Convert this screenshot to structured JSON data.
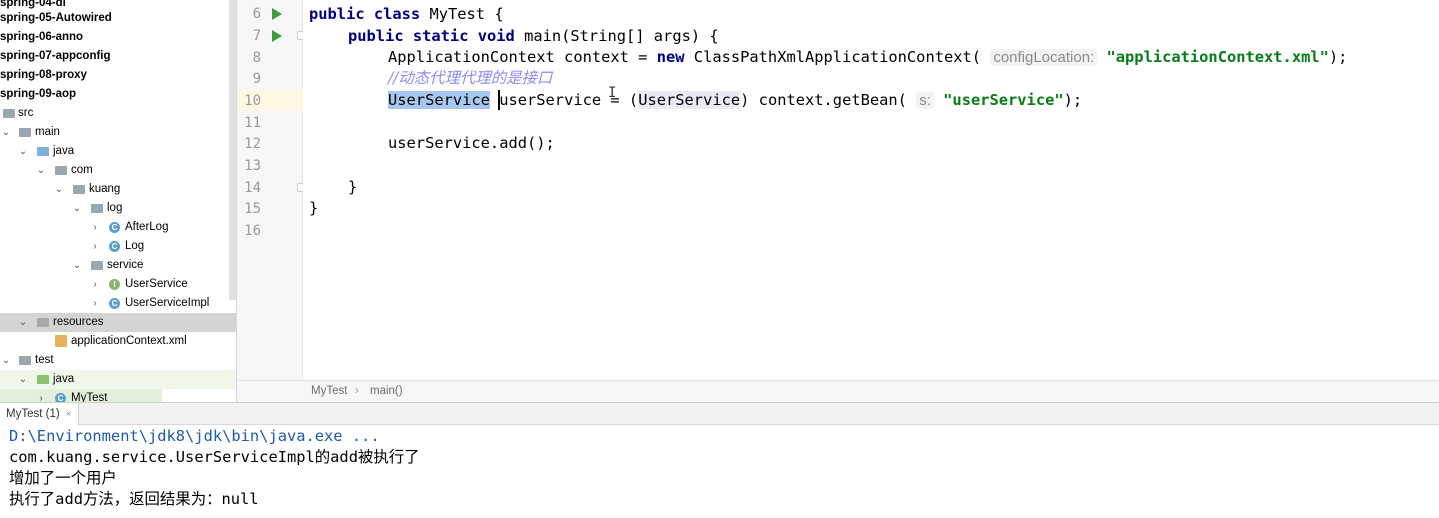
{
  "tree": {
    "items": [
      {
        "label": "spring-04-di",
        "bold": true
      },
      {
        "label": "spring-05-Autowired",
        "bold": true
      },
      {
        "label": "spring-06-anno",
        "bold": true
      },
      {
        "label": "spring-07-appconfig",
        "bold": true
      },
      {
        "label": "spring-08-proxy",
        "bold": true
      },
      {
        "label": "spring-09-aop",
        "bold": true
      },
      {
        "label": "src"
      },
      {
        "label": "main"
      },
      {
        "label": "java"
      },
      {
        "label": "com"
      },
      {
        "label": "kuang"
      },
      {
        "label": "log"
      },
      {
        "label": "AfterLog",
        "icon_text": "C"
      },
      {
        "label": "Log",
        "icon_text": "C"
      },
      {
        "label": "service"
      },
      {
        "label": "UserService",
        "icon_text": "I"
      },
      {
        "label": "UserServiceImpl",
        "icon_text": "C"
      },
      {
        "label": "resources"
      },
      {
        "label": "applicationContext.xml"
      },
      {
        "label": "test"
      },
      {
        "label": "java"
      },
      {
        "label": "MyTest",
        "icon_text": "C"
      }
    ]
  },
  "editor": {
    "line_numbers": [
      "6",
      "7",
      "8",
      "9",
      "10",
      "11",
      "12",
      "13",
      "14",
      "15",
      "16"
    ],
    "lines": {
      "l6": {
        "kw": "public class",
        "rest": " MyTest {"
      },
      "l7": {
        "kw": "public static void",
        "rest": " main(String[] args) {"
      },
      "l8": {
        "pre": "ApplicationContext context = ",
        "kw": "new",
        "mid": " ClassPathXmlApplicationContext( ",
        "hint": "configLocation:",
        "str": "\"applicationContext.xml\"",
        "end": ");"
      },
      "l9": {
        "comment": "//动态代理代理的是接口"
      },
      "l10": {
        "sel": "UserService",
        "a": " userService = (",
        "ref": "UserService",
        "b": ") context.getBean( ",
        "hint": "s:",
        "str": "\"userService\"",
        "end": ");"
      },
      "l12": {
        "text": "userService.add();"
      },
      "l14": {
        "text": "}"
      },
      "l15": {
        "text": "}"
      }
    }
  },
  "breadcrumb": {
    "class": "MyTest",
    "separator": "›",
    "method": "main()"
  },
  "run": {
    "tab_label": "MyTest (1)",
    "console": [
      "D:\\Environment\\jdk8\\jdk\\bin\\java.exe ...",
      "com.kuang.service.UserServiceImpl的add被执行了",
      "增加了一个用户",
      "执行了add方法，返回结果为：null"
    ]
  },
  "colors": {
    "keyword": "#000080",
    "string": "#067d17",
    "comment": "#8c8cf0",
    "selection": "#a6c8f0",
    "run_arrow": "#3e9d3e"
  }
}
